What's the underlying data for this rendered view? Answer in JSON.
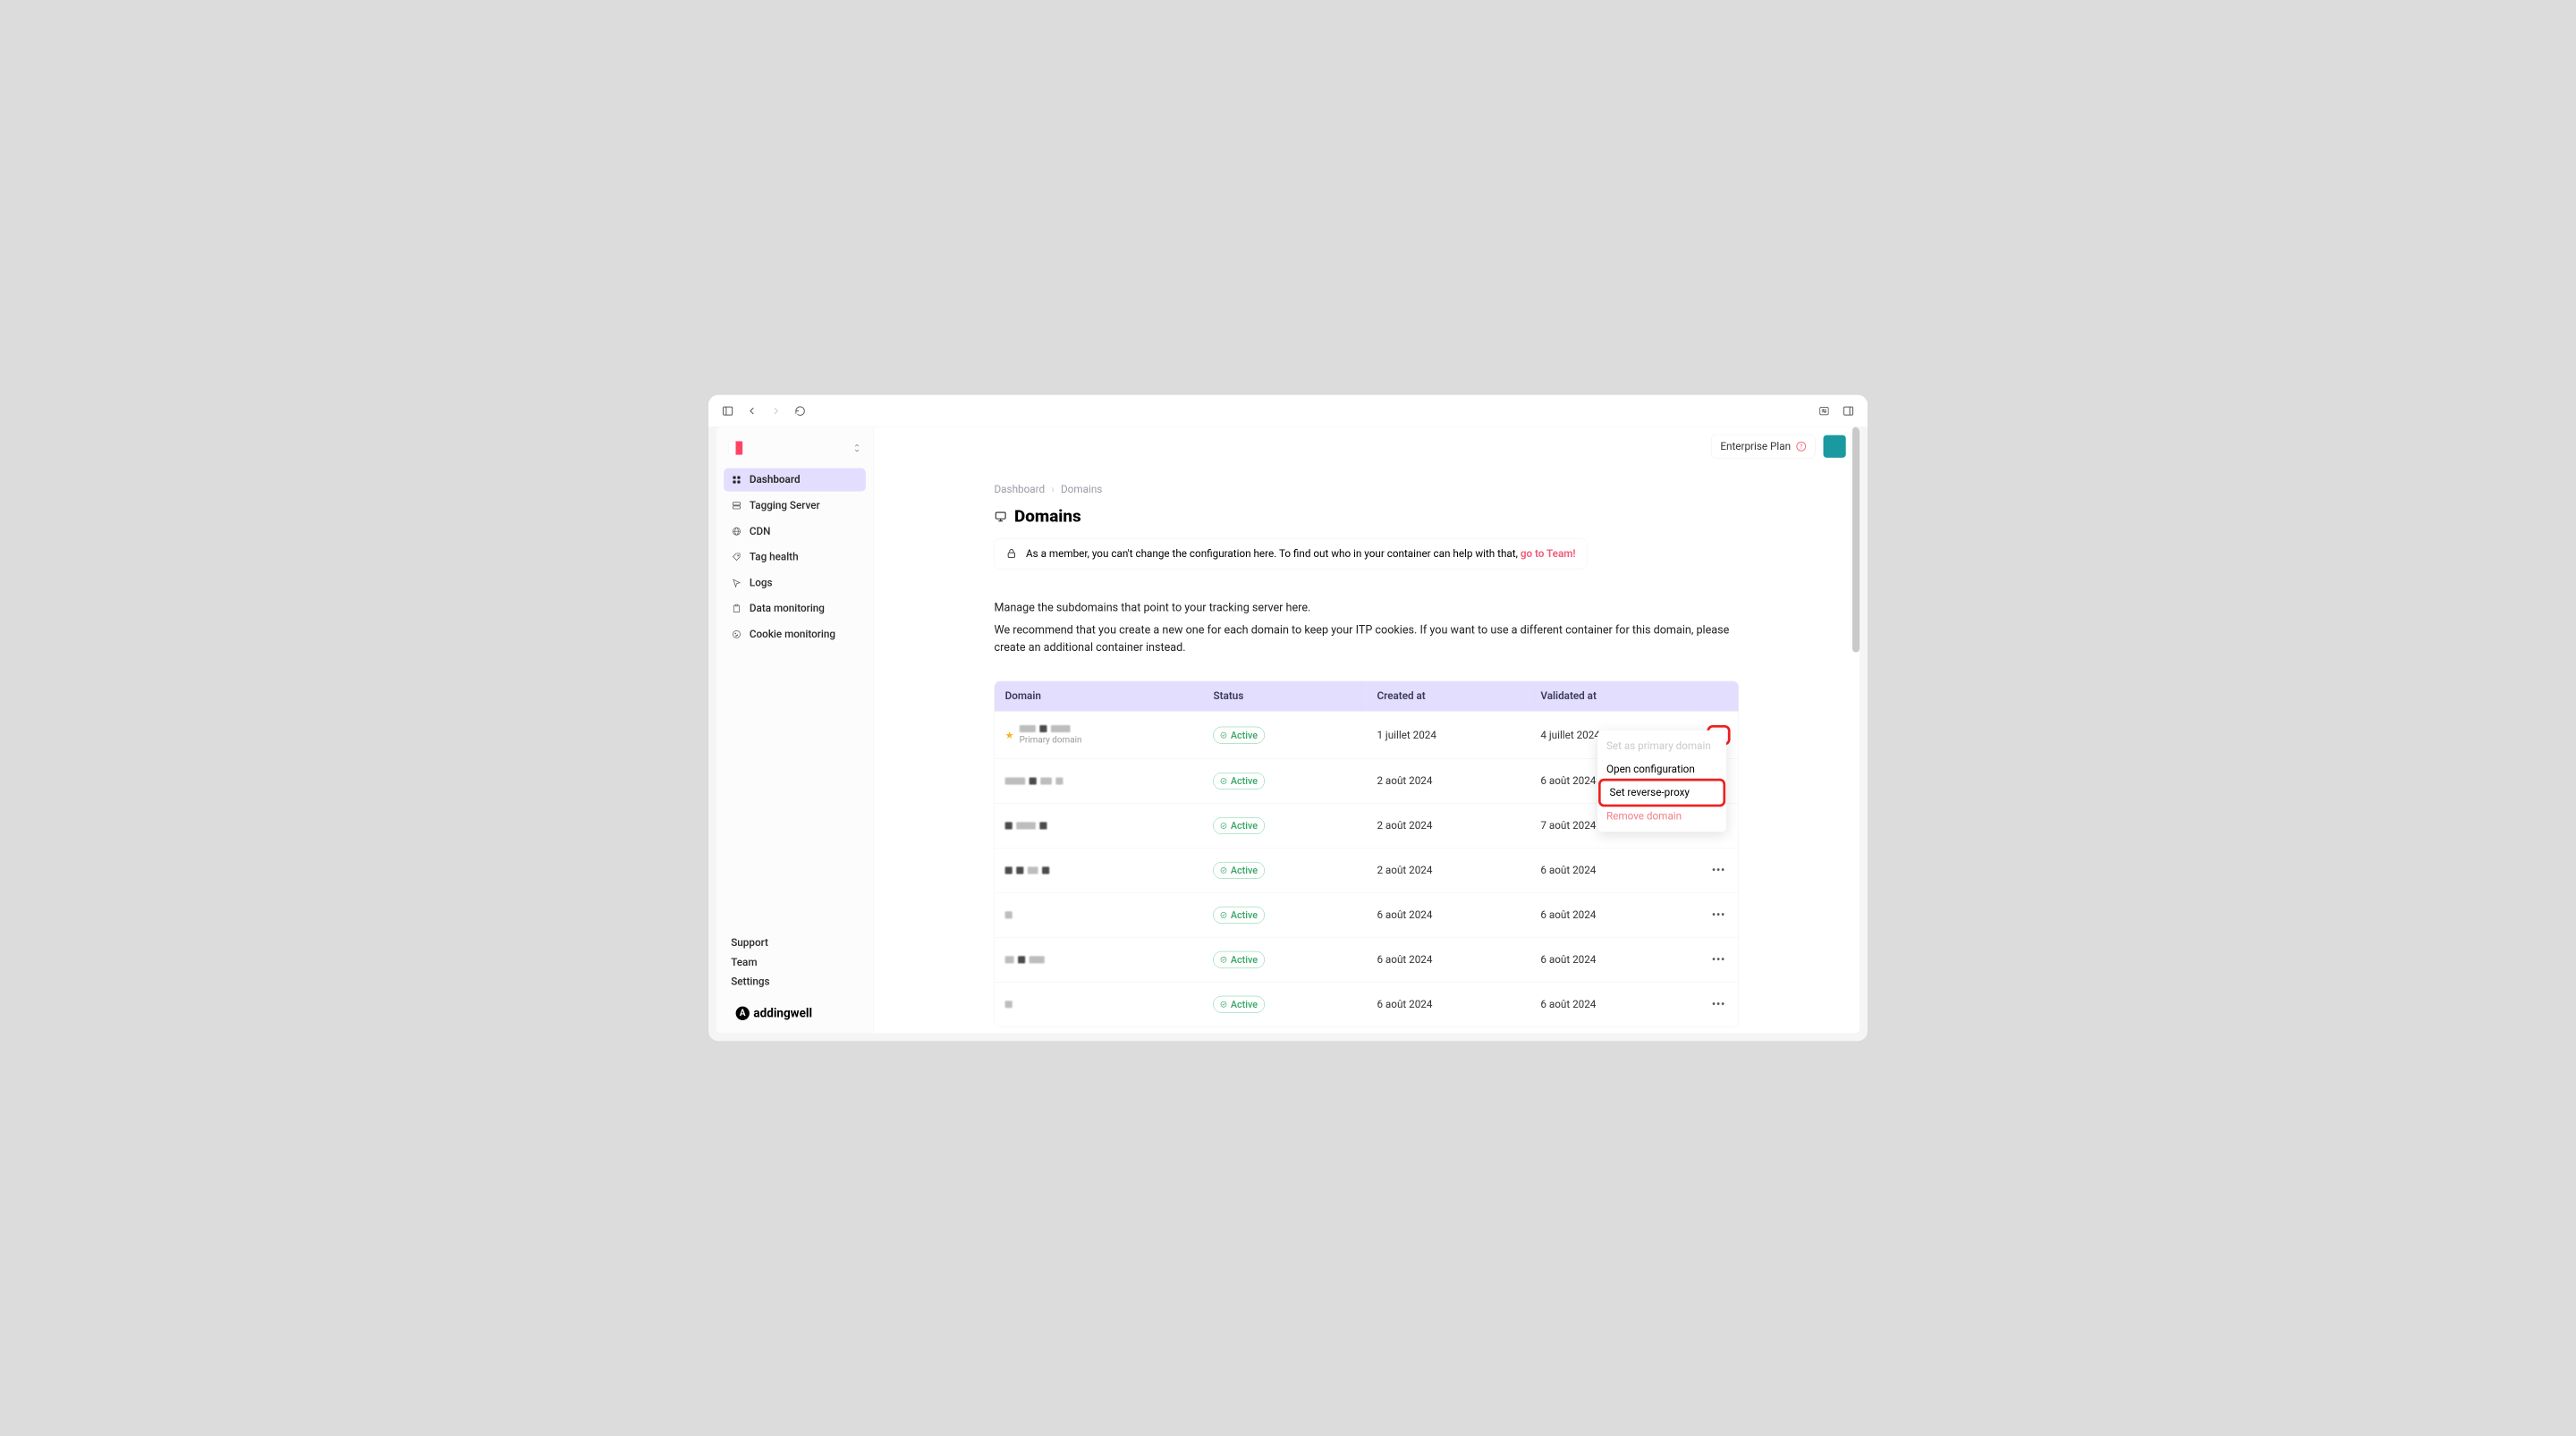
{
  "topbar": {
    "plan_label": "Enterprise Plan"
  },
  "sidebar": {
    "workspace_name": "",
    "items": [
      {
        "label": "Dashboard",
        "icon": "grid"
      },
      {
        "label": "Tagging Server",
        "icon": "server"
      },
      {
        "label": "CDN",
        "icon": "globe"
      },
      {
        "label": "Tag health",
        "icon": "tag"
      },
      {
        "label": "Logs",
        "icon": "cursor"
      },
      {
        "label": "Data monitoring",
        "icon": "clipboard"
      },
      {
        "label": "Cookie monitoring",
        "icon": "cookie"
      }
    ],
    "footer": {
      "support": "Support",
      "team": "Team",
      "settings": "Settings"
    },
    "brand": "addingwell"
  },
  "breadcrumb": {
    "root": "Dashboard",
    "current": "Domains"
  },
  "page": {
    "title": "Domains",
    "banner_prefix": "As a member, you can't change the configuration here. To find out who in your container can help with that, ",
    "banner_link": "go to Team!",
    "desc1": "Manage the subdomains that point to your tracking server here.",
    "desc2": "We recommend that you create a new one for each domain to keep your ITP cookies. If you want to use a different container for this domain, please create an additional container instead."
  },
  "table": {
    "headers": {
      "domain": "Domain",
      "status": "Status",
      "created": "Created at",
      "validated": "Validated at"
    },
    "status_active": "Active",
    "primary_label": "Primary domain",
    "rows": [
      {
        "primary": true,
        "created": "1 juillet 2024",
        "validated": "4 juillet 2024"
      },
      {
        "primary": false,
        "created": "2 août 2024",
        "validated": "6 août 2024"
      },
      {
        "primary": false,
        "created": "2 août 2024",
        "validated": "7 août 2024"
      },
      {
        "primary": false,
        "created": "2 août 2024",
        "validated": "6 août 2024"
      },
      {
        "primary": false,
        "created": "6 août 2024",
        "validated": "6 août 2024"
      },
      {
        "primary": false,
        "created": "6 août 2024",
        "validated": "6 août 2024"
      },
      {
        "primary": false,
        "created": "6 août 2024",
        "validated": "6 août 2024"
      }
    ]
  },
  "action_menu": {
    "set_primary": "Set as primary domain",
    "open_config": "Open configuration",
    "set_reverse": "Set reverse-proxy",
    "remove": "Remove domain"
  }
}
